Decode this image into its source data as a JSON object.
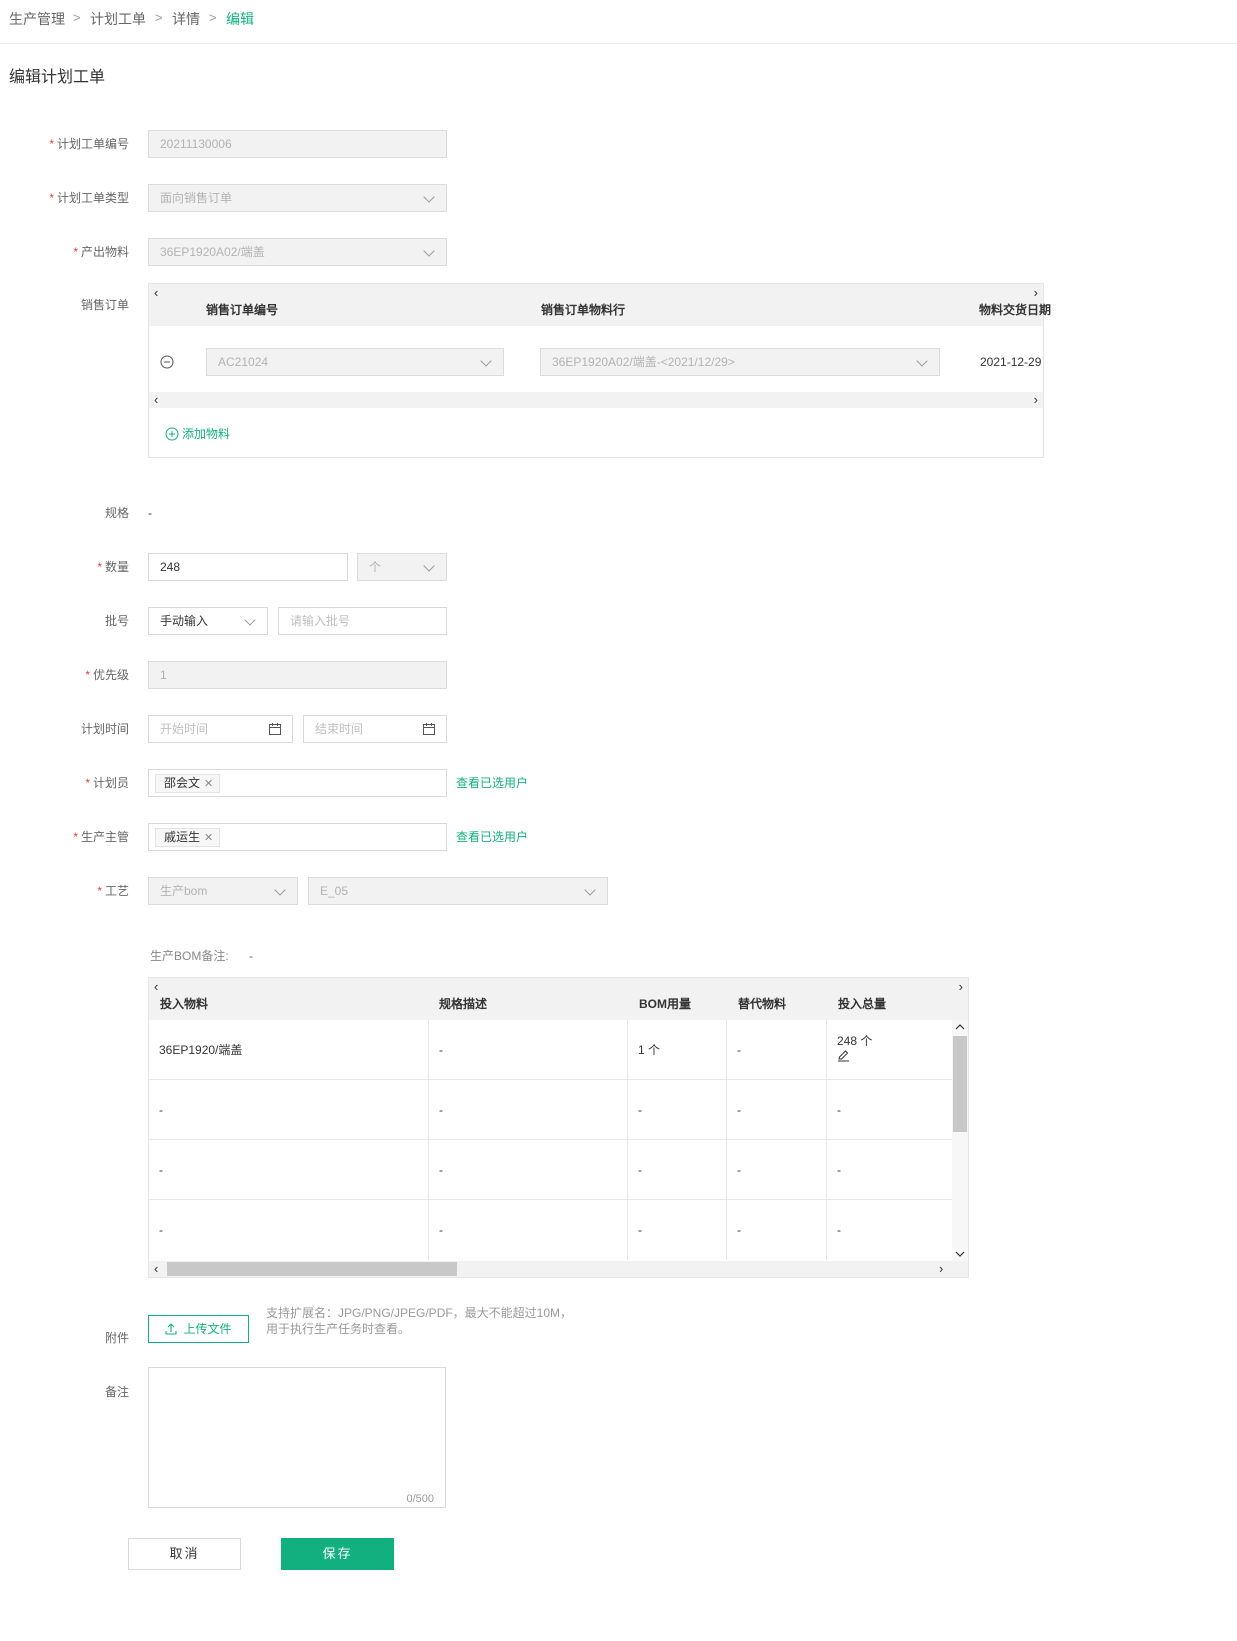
{
  "breadcrumb": [
    "生产管理",
    "计划工单",
    "详情",
    "编辑"
  ],
  "breadcrumb_separator": ">",
  "page_title": "编辑计划工单",
  "required_mark": "*",
  "form": {
    "order_no": {
      "label": "计划工单编号",
      "value": "20211130006"
    },
    "order_type": {
      "label": "计划工单类型",
      "value": "面向销售订单"
    },
    "output_material": {
      "label": "产出物料",
      "value": "36EP1920A02/端盖"
    },
    "sales_order": {
      "label": "销售订单",
      "columns": [
        "销售订单编号",
        "销售订单物料行",
        "物料交货日期"
      ],
      "rows": [
        {
          "order_no": "AC21024",
          "material_line": "36EP1920A02/端盖-<2021/12/29>",
          "delivery_date": "2021-12-29"
        }
      ],
      "add_label": "添加物料"
    },
    "spec": {
      "label": "规格",
      "value": "-"
    },
    "quantity": {
      "label": "数量",
      "value": "248",
      "unit": "个"
    },
    "batch": {
      "label": "批号",
      "mode": "手动输入",
      "placeholder": "请输入批号"
    },
    "priority": {
      "label": "优先级",
      "value": "1"
    },
    "plan_time": {
      "label": "计划时间",
      "start_placeholder": "开始时间",
      "end_placeholder": "结束时间"
    },
    "planner": {
      "label": "计划员",
      "tag": "邵会文",
      "tag_close": "✕",
      "view_link": "查看已选用户"
    },
    "supervisor": {
      "label": "生产主管",
      "tag": "戚运生",
      "tag_close": "✕",
      "view_link": "查看已选用户"
    },
    "process": {
      "label": "工艺",
      "bom_type": "生产bom",
      "bom_version": "E_05"
    },
    "bom_note": {
      "label": "生产BOM备注:",
      "value": "-"
    },
    "bom_table": {
      "columns": [
        "投入物料",
        "规格描述",
        "BOM用量",
        "替代物料",
        "投入总量"
      ],
      "rows": [
        [
          "36EP1920/端盖",
          "-",
          "1 个",
          "-",
          "248 个"
        ],
        [
          "-",
          "-",
          "-",
          "-",
          "-"
        ],
        [
          "-",
          "-",
          "-",
          "-",
          "-"
        ],
        [
          "-",
          "-",
          "-",
          "-",
          "-"
        ]
      ]
    },
    "attachment": {
      "label": "附件",
      "button": "上传文件",
      "hint": "支持扩展名：JPG/PNG/JPEG/PDF，最大不能超过10M，用于执行生产任务时查看。"
    },
    "remark": {
      "label": "备注",
      "counter": "0/500"
    }
  },
  "actions": {
    "cancel": "取消",
    "save": "保存"
  },
  "colors": {
    "primary": "#13b07f",
    "required": "#e83b3b",
    "disabled_bg": "#f2f2f2"
  }
}
